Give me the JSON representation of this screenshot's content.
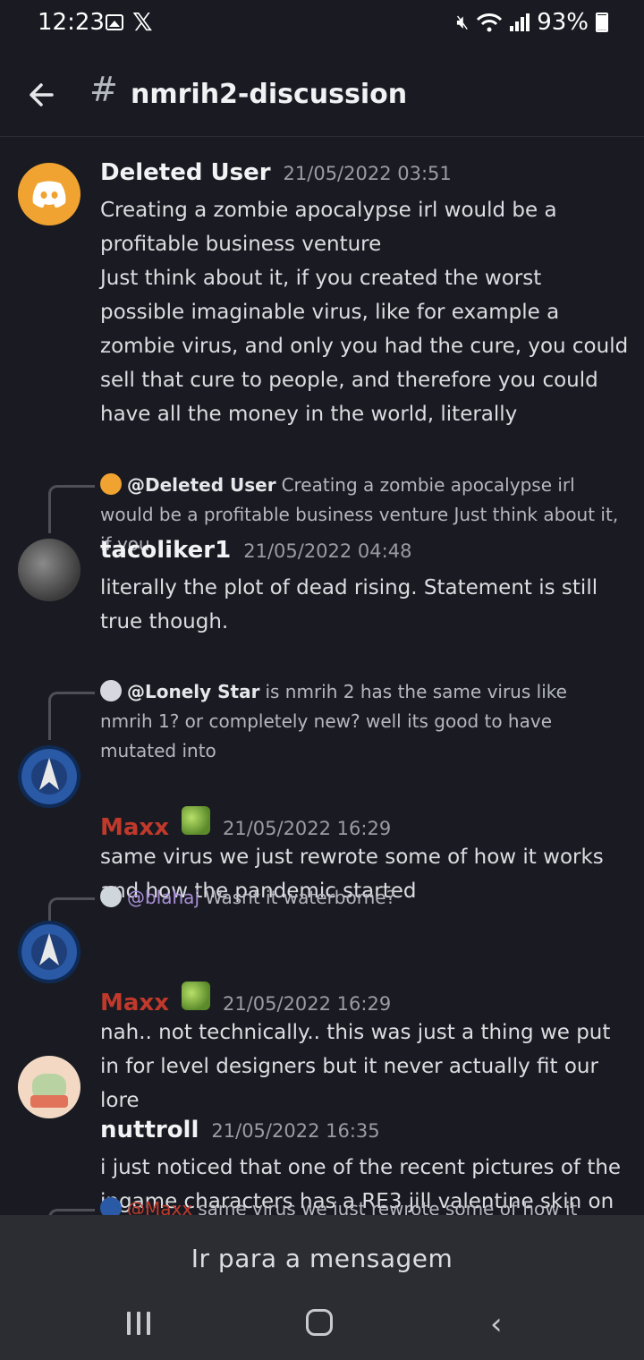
{
  "status_bar": {
    "time": "12:23",
    "battery": "93%"
  },
  "header": {
    "channel_hash": "#",
    "channel_name": "nmrih2-discussion"
  },
  "messages": [
    {
      "username": "Deleted User",
      "timestamp": "21/05/2022 03:51",
      "body": "Creating a zombie apocalypse irl would be a profitable business venture\nJust think about it, if you created the worst possible imaginable virus, like for example a zombie virus, and only you had the cure, you could sell that cure to people, and therefore you could have all the money in the world, literally"
    },
    {
      "reply": {
        "name": "@Deleted User",
        "text": "Creating a zombie apocalypse irl would be a profitable business venture Just think about it, if you"
      },
      "username": "tacoliker1",
      "timestamp": "21/05/2022 04:48",
      "body": "literally the plot of dead rising. Statement is still true though."
    },
    {
      "reply": {
        "name": "@Lonely Star",
        "text": "is nmrih 2 has the same virus like nmrih 1? or completely new? well its good to have mutated into"
      },
      "username": "Maxx",
      "timestamp": "21/05/2022 16:29",
      "body": "same virus we just rewrote some of how it works and how the pandemic started"
    },
    {
      "reply": {
        "name": "@blahaj",
        "text": "Wasnt it waterborne?"
      },
      "username": "Maxx",
      "timestamp": "21/05/2022 16:29",
      "body": "nah.. not technically.. this was just a thing we put in for level designers but it never actually fit our lore"
    },
    {
      "username": "nuttroll",
      "timestamp": "21/05/2022 16:35",
      "body": "i just noticed that one of the recent pictures of the ingame characters has a RE3 jill valentine skin on"
    },
    {
      "reply": {
        "name": "@Maxx",
        "text": "same virus we just rewrote some of how it"
      }
    }
  ],
  "jump_bar": {
    "label": "Ir para a mensagem"
  },
  "colors": {
    "maxx_name": "#c0392b",
    "blahaj_name": "#a88fd8",
    "discord_orange": "#f0a330"
  }
}
